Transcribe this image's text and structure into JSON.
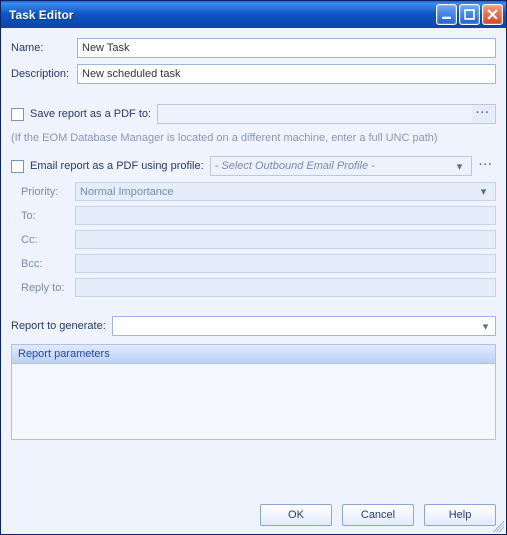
{
  "window": {
    "title": "Task Editor"
  },
  "fields": {
    "name_label": "Name:",
    "name_value": "New Task",
    "description_label": "Description:",
    "description_value": "New scheduled task"
  },
  "save_pdf": {
    "checkbox_label": "Save report as a PDF to:",
    "path": "",
    "hint": "(If the EOM Database Manager is located on a different machine, enter a full UNC path)"
  },
  "email": {
    "checkbox_label": "Email report as a PDF using profile:",
    "profile_placeholder": "- Select Outbound Email Profile -",
    "priority_label": "Priority:",
    "priority_value": "Normal Importance",
    "to_label": "To:",
    "to_value": "",
    "cc_label": "Cc:",
    "cc_value": "",
    "bcc_label": "Bcc:",
    "bcc_value": "",
    "replyto_label": "Reply to:",
    "replyto_value": ""
  },
  "report": {
    "label": "Report to generate:",
    "selected": ""
  },
  "params": {
    "header": "Report parameters"
  },
  "buttons": {
    "ok": "OK",
    "cancel": "Cancel",
    "help": "Help"
  },
  "glyphs": {
    "ellipsis": "···",
    "caret": "▾"
  }
}
